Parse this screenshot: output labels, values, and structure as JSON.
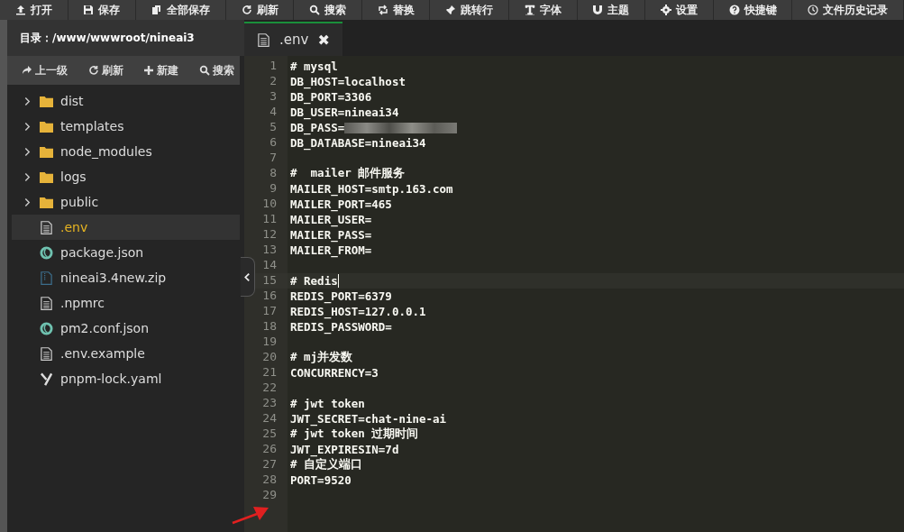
{
  "toolbar": [
    {
      "label": "打开"
    },
    {
      "label": "保存"
    },
    {
      "label": "全部保存"
    },
    {
      "label": "刷新"
    },
    {
      "label": "搜索"
    },
    {
      "label": "替换"
    },
    {
      "label": "跳转行"
    },
    {
      "label": "字体"
    },
    {
      "label": "主题"
    },
    {
      "label": "设置"
    },
    {
      "label": "快捷键"
    },
    {
      "label": "文件历史记录"
    }
  ],
  "sidebar": {
    "path": "目录：/www/wwwroot/nineai3",
    "actions": [
      {
        "label": "上一级"
      },
      {
        "label": "刷新"
      },
      {
        "label": "新建"
      },
      {
        "label": "搜索"
      }
    ],
    "files": [
      {
        "kind": "folder",
        "name": "dist",
        "selected": false
      },
      {
        "kind": "folder",
        "name": "templates",
        "selected": false
      },
      {
        "kind": "folder",
        "name": "node_modules",
        "selected": false
      },
      {
        "kind": "folder",
        "name": "logs",
        "selected": false
      },
      {
        "kind": "folder",
        "name": "public",
        "selected": false
      },
      {
        "kind": "text",
        "name": ".env",
        "selected": true
      },
      {
        "kind": "json",
        "name": "package.json",
        "selected": false
      },
      {
        "kind": "zip",
        "name": "nineai3.4new.zip",
        "selected": false
      },
      {
        "kind": "text",
        "name": ".npmrc",
        "selected": false
      },
      {
        "kind": "json",
        "name": "pm2.conf.json",
        "selected": false
      },
      {
        "kind": "text",
        "name": ".env.example",
        "selected": false
      },
      {
        "kind": "yaml",
        "name": "pnpm-lock.yaml",
        "selected": false
      }
    ]
  },
  "tabs": [
    {
      "label": ".env",
      "close": "✖",
      "selected": true
    }
  ],
  "editor": {
    "lines": [
      {
        "no": "1",
        "text": "# mysql",
        "selected": false
      },
      {
        "no": "2",
        "text": "DB_HOST=localhost",
        "selected": false
      },
      {
        "no": "3",
        "text": "DB_PORT=3306",
        "selected": false
      },
      {
        "no": "4",
        "text": "DB_USER=nineai34",
        "selected": false
      },
      {
        "no": "5",
        "text": "DB_PASS=",
        "redacted": true,
        "selected": false
      },
      {
        "no": "6",
        "text": "DB_DATABASE=nineai34",
        "selected": false
      },
      {
        "no": "7",
        "selected": false
      },
      {
        "no": "8",
        "text": "#  mailer 邮件服务",
        "selected": false
      },
      {
        "no": "9",
        "text": "MAILER_HOST=smtp.163.com",
        "selected": false
      },
      {
        "no": "10",
        "text": "MAILER_PORT=465",
        "selected": false
      },
      {
        "no": "11",
        "text": "MAILER_USER=",
        "selected": false
      },
      {
        "no": "12",
        "text": "MAILER_PASS=",
        "selected": false
      },
      {
        "no": "13",
        "text": "MAILER_FROM=",
        "selected": false
      },
      {
        "no": "14",
        "selected": false
      },
      {
        "no": "15",
        "text": "# Redis",
        "selected": true
      },
      {
        "no": "16",
        "text": "REDIS_PORT=6379",
        "selected": false
      },
      {
        "no": "17",
        "text": "REDIS_HOST=127.0.0.1",
        "selected": false
      },
      {
        "no": "18",
        "text": "REDIS_PASSWORD=",
        "selected": false
      },
      {
        "no": "19",
        "selected": false
      },
      {
        "no": "20",
        "text": "# mj并发数",
        "selected": false
      },
      {
        "no": "21",
        "text": "CONCURRENCY=3",
        "selected": false
      },
      {
        "no": "22",
        "selected": false
      },
      {
        "no": "23",
        "text": "# jwt token",
        "selected": false
      },
      {
        "no": "24",
        "text": "JWT_SECRET=chat-nine-ai",
        "selected": false
      },
      {
        "no": "25",
        "text": "# jwt token 过期时间",
        "selected": false
      },
      {
        "no": "26",
        "text": "JWT_EXPIRESIN=7d",
        "selected": false
      },
      {
        "no": "27",
        "text": "# 自定义端口",
        "selected": false
      },
      {
        "no": "28",
        "text": "PORT=9520",
        "selected": false
      },
      {
        "no": "29",
        "selected": false
      }
    ]
  }
}
